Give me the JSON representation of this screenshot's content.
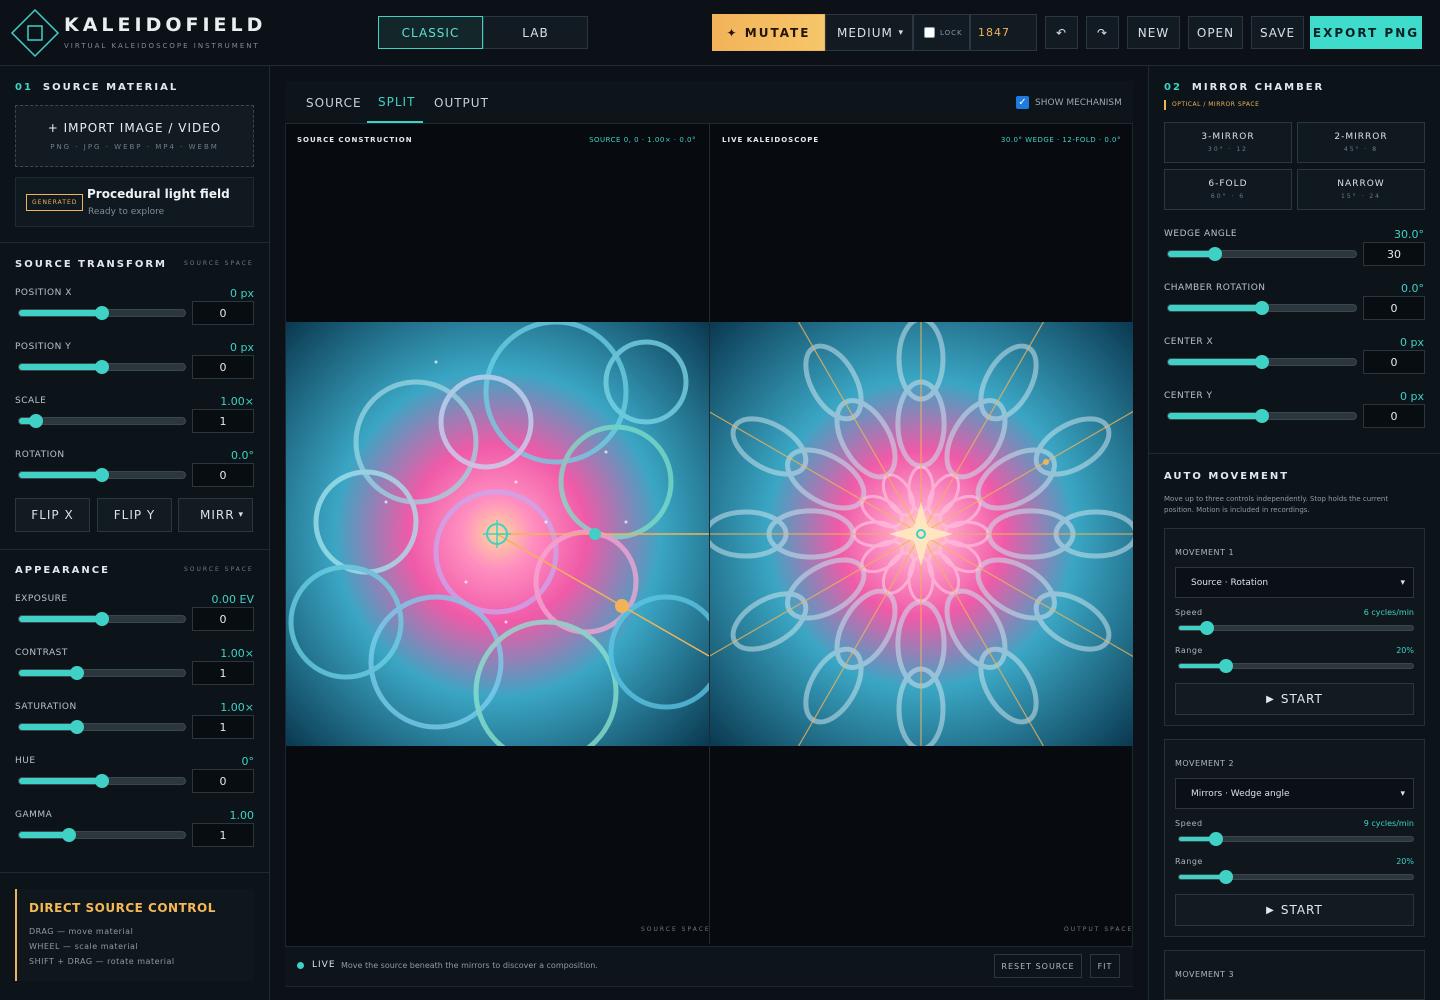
{
  "app": {
    "title": "KALEIDOFIELD",
    "subtitle": "VIRTUAL KALEIDOSCOPE INSTRUMENT"
  },
  "toolbar": {
    "mode_classic": "CLASSIC",
    "mode_lab": "LAB",
    "mutate": "✦ MUTATE",
    "level": "MEDIUM",
    "lock": "LOCK",
    "seed": "1847",
    "undo": "↶",
    "redo": "↷",
    "new": "NEW",
    "open": "OPEN",
    "save": "SAVE",
    "export": "EXPORT PNG"
  },
  "left": {
    "source_num": "01",
    "source_title": "SOURCE MATERIAL",
    "import_title": "+ IMPORT IMAGE / VIDEO",
    "import_formats": "PNG · JPG · WEBP · MP4 · WEBM",
    "generated_badge": "GENERATED",
    "source_name": "Procedural light field",
    "source_status": "Ready to explore",
    "transform_title": "SOURCE TRANSFORM",
    "transform_tag": "SOURCE SPACE",
    "transform": [
      {
        "label": "POSITION X",
        "value": "0 px",
        "input": "0",
        "fraction": 0.5
      },
      {
        "label": "POSITION Y",
        "value": "0 px",
        "input": "0",
        "fraction": 0.5
      },
      {
        "label": "SCALE",
        "value": "1.00×",
        "input": "1",
        "fraction": 0.1
      },
      {
        "label": "ROTATION",
        "value": "0.0°",
        "input": "0",
        "fraction": 0.5
      }
    ],
    "flip_x": "FLIP X",
    "flip_y": "FLIP Y",
    "mirror_select": "MIRR",
    "appearance_title": "APPEARANCE",
    "appearance_tag": "SOURCE SPACE",
    "appearance": [
      {
        "label": "EXPOSURE",
        "value": "0.00 EV",
        "input": "0",
        "fraction": 0.5
      },
      {
        "label": "CONTRAST",
        "value": "1.00×",
        "input": "1",
        "fraction": 0.35
      },
      {
        "label": "SATURATION",
        "value": "1.00×",
        "input": "1",
        "fraction": 0.35
      },
      {
        "label": "HUE",
        "value": "0°",
        "input": "0",
        "fraction": 0.5
      },
      {
        "label": "GAMMA",
        "value": "1.00",
        "input": "1",
        "fraction": 0.3
      }
    ],
    "direct_title": "DIRECT SOURCE CONTROL",
    "direct_lines": [
      "DRAG — move material",
      "WHEEL — scale material",
      "SHIFT + DRAG — rotate material"
    ]
  },
  "center": {
    "tabs": [
      "SOURCE",
      "SPLIT",
      "OUTPUT"
    ],
    "show_mechanism": "SHOW MECHANISM",
    "left_header": "SOURCE CONSTRUCTION",
    "left_info": "SOURCE 0, 0 · 1.00× · 0.0°",
    "right_header": "LIVE KALEIDOSCOPE",
    "right_info": "30.0° WEDGE · 12-FOLD · 0.0°",
    "left_space": "SOURCE SPACE",
    "right_space": "OUTPUT SPACE",
    "live_label": "LIVE",
    "live_text": "Move the source beneath the mirrors to discover a composition.",
    "reset_source": "RESET SOURCE",
    "fit": "FIT"
  },
  "right": {
    "chamber_num": "02",
    "chamber_title": "MIRROR CHAMBER",
    "chamber_tag": "OPTICAL / MIRROR SPACE",
    "presets": [
      {
        "name": "3-MIRROR",
        "spec": "30° · 12"
      },
      {
        "name": "2-MIRROR",
        "spec": "45° · 8"
      },
      {
        "name": "6-FOLD",
        "spec": "60° · 6"
      },
      {
        "name": "NARROW",
        "spec": "15° · 24"
      }
    ],
    "controls": [
      {
        "label": "WEDGE ANGLE",
        "value": "30.0°",
        "input": "30",
        "fraction": 0.25
      },
      {
        "label": "CHAMBER ROTATION",
        "value": "0.0°",
        "input": "0",
        "fraction": 0.5
      },
      {
        "label": "CENTER X",
        "value": "0 px",
        "input": "0",
        "fraction": 0.5
      },
      {
        "label": "CENTER Y",
        "value": "0 px",
        "input": "0",
        "fraction": 0.5
      }
    ],
    "auto_title": "AUTO MOVEMENT",
    "auto_desc": "Move up to three controls independently. Stop holds the current position. Motion is included in recordings.",
    "movements": [
      {
        "title": "MOVEMENT 1",
        "target": "Source · Rotation",
        "speed_label": "Speed",
        "speed": "6 cycles/min",
        "speed_fraction": 0.12,
        "range_label": "Range",
        "range": "20%",
        "range_fraction": 0.2,
        "start": "START"
      },
      {
        "title": "MOVEMENT 2",
        "target": "Mirrors · Wedge angle",
        "speed_label": "Speed",
        "speed": "9 cycles/min",
        "speed_fraction": 0.16,
        "range_label": "Range",
        "range": "20%",
        "range_fraction": 0.2,
        "start": "START"
      },
      {
        "title": "MOVEMENT 3"
      }
    ]
  },
  "colors": {
    "accent": "#3fd1c6",
    "warm": "#f0b35a",
    "bg": "#0b1116"
  }
}
